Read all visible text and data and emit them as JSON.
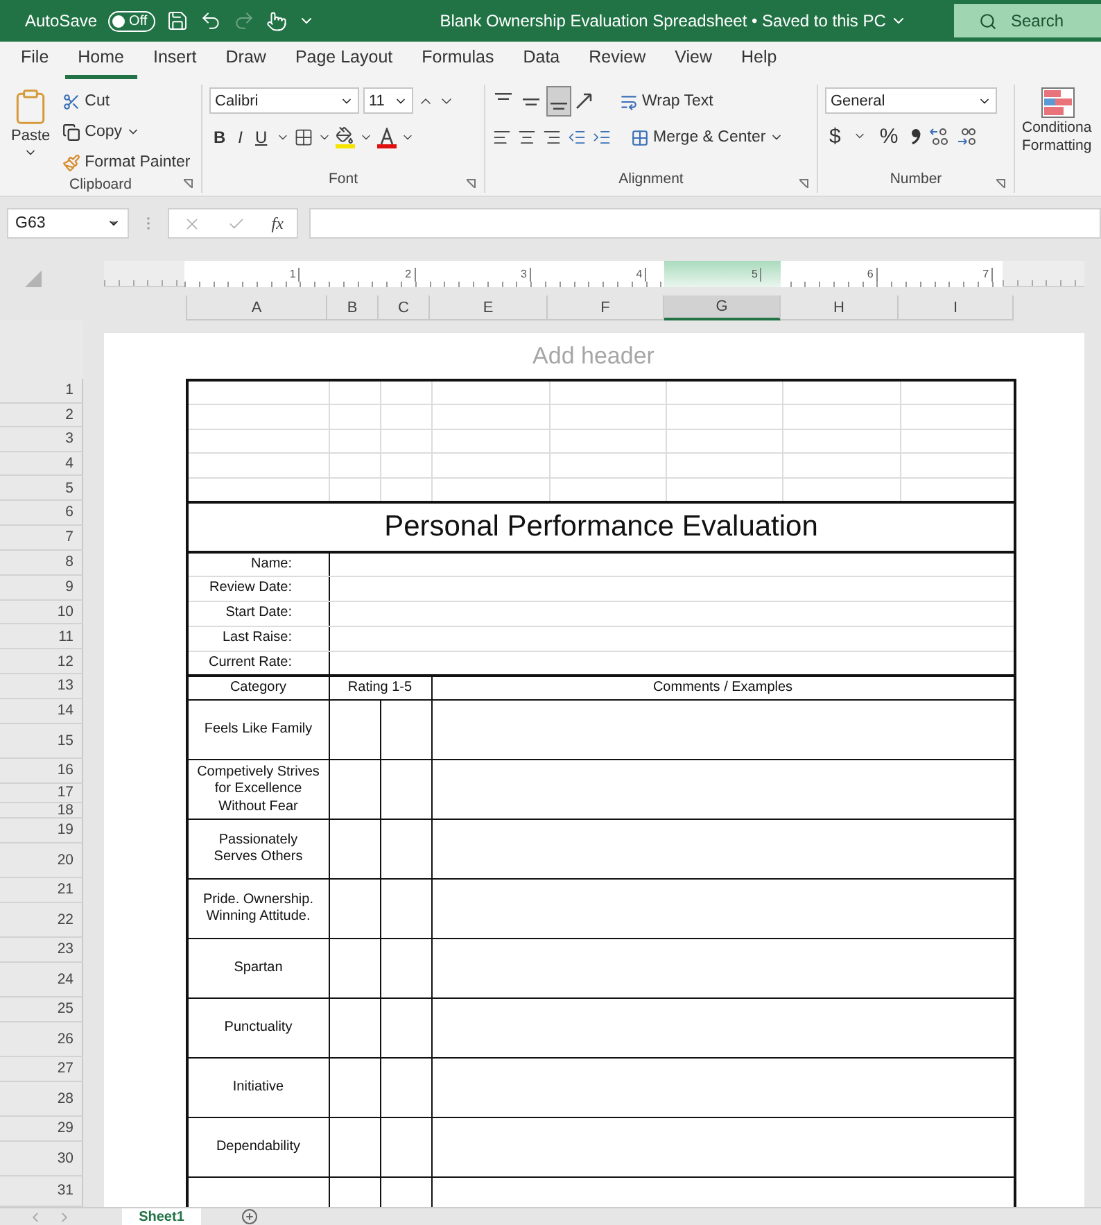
{
  "title_bar": {
    "autosave_label": "AutoSave",
    "autosave_on": false,
    "autosave_state": "Off",
    "redo_enabled": false,
    "document_title": "Blank Ownership Evaluation Spreadsheet • Saved to this PC",
    "search_placeholder": "Search"
  },
  "menu_tabs": [
    {
      "label": "File",
      "selected": false
    },
    {
      "label": "Home",
      "selected": true
    },
    {
      "label": "Insert",
      "selected": false
    },
    {
      "label": "Draw",
      "selected": false
    },
    {
      "label": "Page Layout",
      "selected": false
    },
    {
      "label": "Formulas",
      "selected": false
    },
    {
      "label": "Data",
      "selected": false
    },
    {
      "label": "Review",
      "selected": false
    },
    {
      "label": "View",
      "selected": false
    },
    {
      "label": "Help",
      "selected": false
    }
  ],
  "ribbon": {
    "clipboard": {
      "paste": "Paste",
      "cut": "Cut",
      "copy": "Copy",
      "format_painter": "Format Painter",
      "label": "Clipboard"
    },
    "font": {
      "font_name": "Calibri",
      "font_size": "11",
      "bold": "B",
      "italic": "I",
      "underline": "U",
      "label": "Font"
    },
    "alignment": {
      "vertical_align": [
        {
          "selected": false
        },
        {
          "selected": false
        },
        {
          "selected": true
        }
      ],
      "wrap_text": "Wrap Text",
      "merge_center": "Merge & Center",
      "label": "Alignment"
    },
    "number": {
      "format": "General",
      "currency": "$",
      "percent": "%",
      "label": "Number"
    },
    "styles": {
      "conditional_formatting": [
        "Conditiona",
        "Formatting"
      ]
    }
  },
  "name_box": "G63",
  "function_label": "fx",
  "ruler_marks": [
    "1",
    "2",
    "3",
    "4",
    "5",
    "6",
    "7"
  ],
  "columns": [
    {
      "label": "A",
      "selected": false
    },
    {
      "label": "B",
      "selected": false
    },
    {
      "label": "C",
      "selected": false
    },
    {
      "label": "E",
      "selected": false
    },
    {
      "label": "F",
      "selected": false
    },
    {
      "label": "G",
      "selected": true
    },
    {
      "label": "H",
      "selected": false
    },
    {
      "label": "I",
      "selected": false
    }
  ],
  "page_header_placeholder": "Add header",
  "row_numbers": [
    "1",
    "2",
    "3",
    "4",
    "5",
    "6",
    "7",
    "8",
    "9",
    "10",
    "11",
    "12",
    "13",
    "14",
    "15",
    "16",
    "17",
    "18",
    "19",
    "20",
    "21",
    "22",
    "23",
    "24",
    "25",
    "26",
    "27",
    "28",
    "29",
    "30",
    "31"
  ],
  "form": {
    "title": "Personal Performance Evaluation",
    "info_fields": [
      "Name:",
      "Review Date:",
      "Start Date:",
      "Last Raise:",
      "Current Rate:"
    ],
    "headers": [
      "Category",
      "Rating 1-5",
      "Comments / Examples"
    ],
    "categories": [
      "Feels Like Family",
      "Competively Strives for Excellence Without Fear",
      "Passionately Serves Others",
      "Pride. Ownership. Winning Attitude.",
      "Spartan",
      "Punctuality",
      "Initiative",
      "Dependability"
    ]
  },
  "sheet_tabs": [
    {
      "label": "Sheet1",
      "selected": true
    }
  ]
}
